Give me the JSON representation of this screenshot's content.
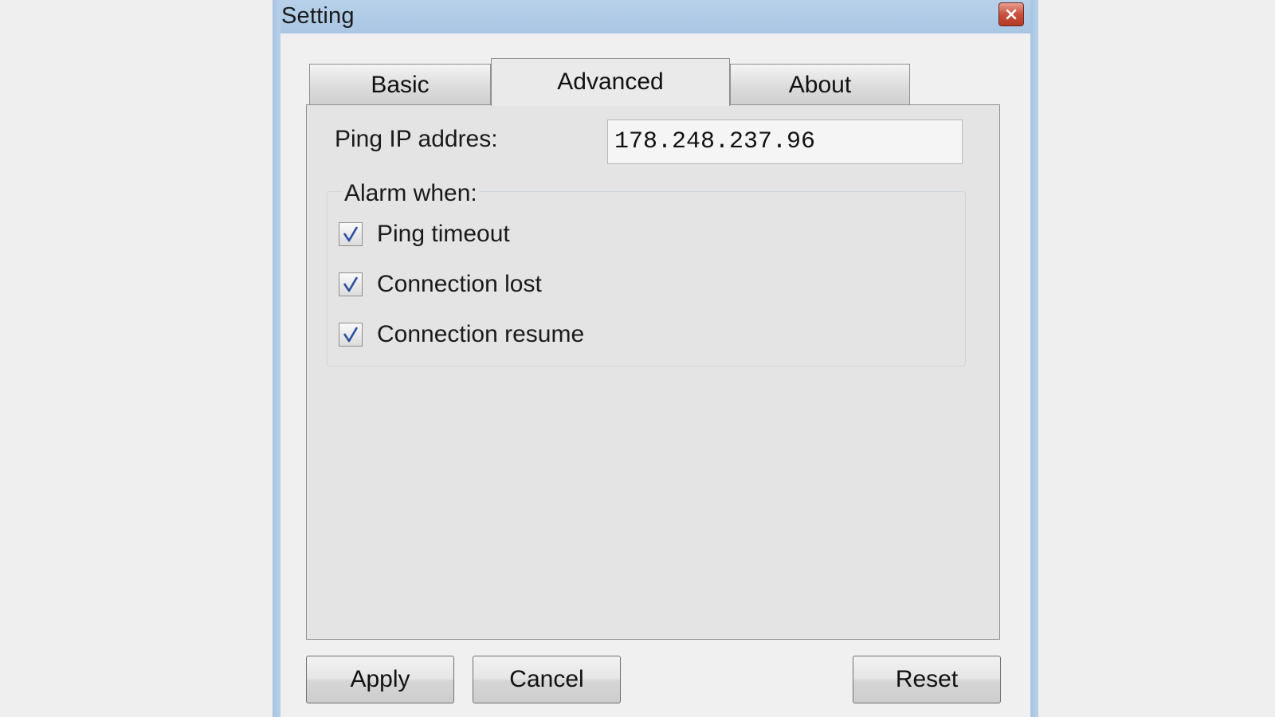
{
  "window": {
    "title": "Setting"
  },
  "tabs": {
    "basic": "Basic",
    "advanced": "Advanced",
    "about": "About",
    "active": "Advanced"
  },
  "advanced": {
    "ping_label": "Ping IP addres:",
    "ping_value": "178.248.237.96",
    "alarm_group_label": "Alarm when:",
    "alarms": [
      {
        "label": "Ping timeout",
        "checked": true
      },
      {
        "label": "Connection lost",
        "checked": true
      },
      {
        "label": "Connection resume",
        "checked": true
      }
    ]
  },
  "buttons": {
    "apply": "Apply",
    "cancel": "Cancel",
    "reset": "Reset"
  },
  "icons": {
    "close": "close-icon",
    "check": "checkmark-icon"
  },
  "colors": {
    "titlebar": "#a9c6e3",
    "close_button": "#c9503c",
    "checkmark": "#2b4fa0"
  }
}
